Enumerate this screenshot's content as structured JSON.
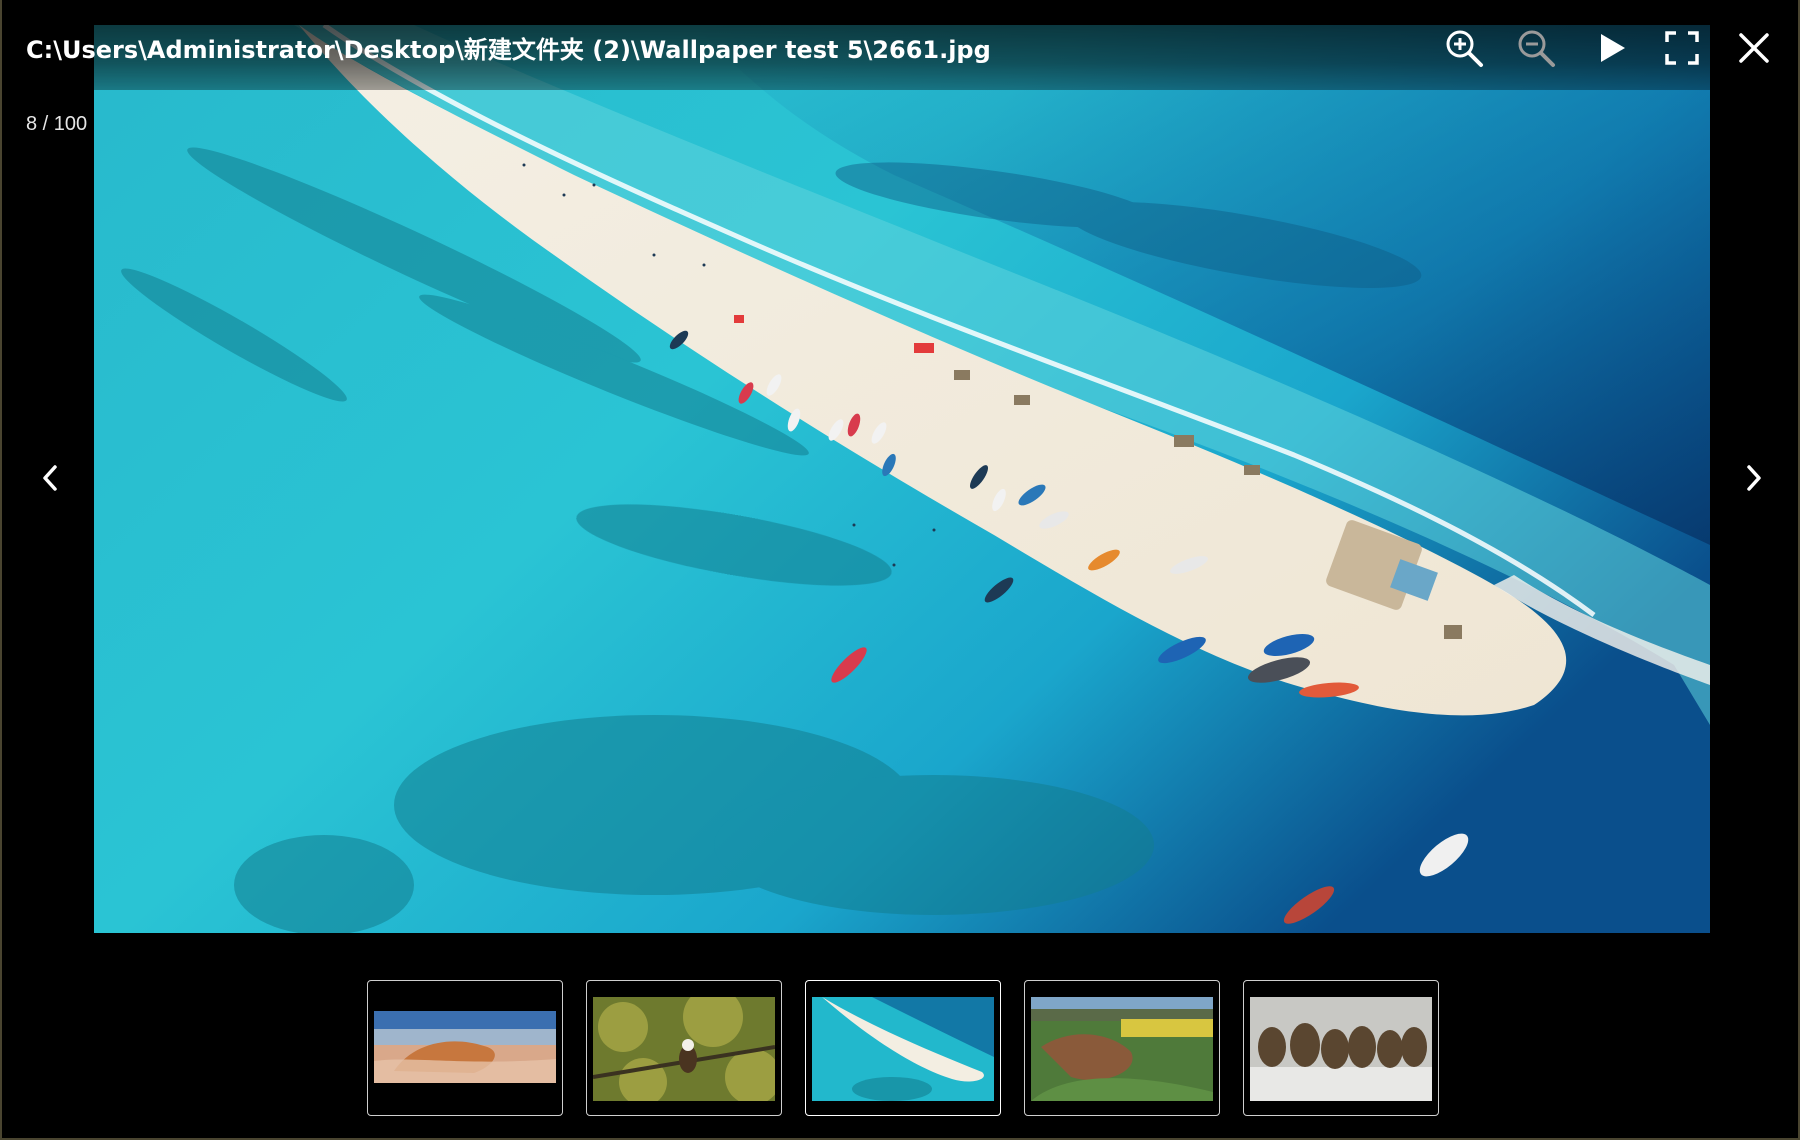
{
  "window": {
    "file_path": "C:\\Users\\Administrator\\Desktop\\新建文件夹 (2)\\Wallpaper test 5\\2661.jpg",
    "counter": "8 / 100"
  },
  "toolbar": {
    "zoom_in_icon": "zoom-in-icon",
    "zoom_out_icon": "zoom-out-icon",
    "play_icon": "play-icon",
    "fullscreen_icon": "fullscreen-icon",
    "close_icon": "close-icon"
  },
  "navigation": {
    "prev_icon": "chevron-left-icon",
    "next_icon": "chevron-right-icon"
  },
  "thumbnails": [
    {
      "name": "cliff-in-fog",
      "active": false
    },
    {
      "name": "eagle-in-tree",
      "active": false
    },
    {
      "name": "beach-sandbar",
      "active": true
    },
    {
      "name": "rock-meadow",
      "active": false
    },
    {
      "name": "bison-in-snow",
      "active": false
    }
  ],
  "colors": {
    "background": "#000000",
    "icon": "#ffffff",
    "icon_disabled": "#9a9a9a",
    "thumb_border": "#cfcfcf"
  }
}
